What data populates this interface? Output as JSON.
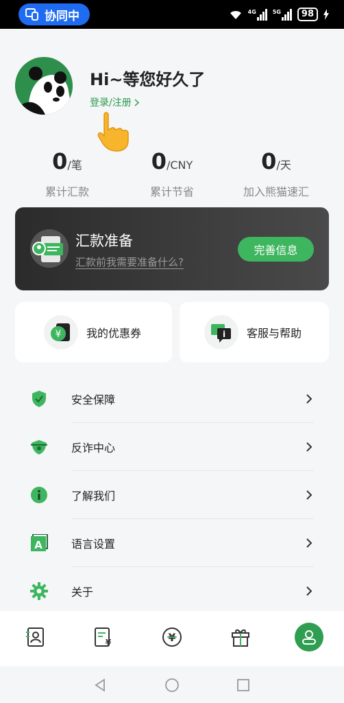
{
  "status_bar": {
    "collab_label": "协同中",
    "net1": "4G",
    "net2": "5G",
    "battery": "98"
  },
  "header": {
    "greeting": "Hi~等您好久了",
    "login_link": "登录/注册"
  },
  "stats": [
    {
      "value": "0",
      "unit": "/笔",
      "label": "累计汇款"
    },
    {
      "value": "0",
      "unit": "/CNY",
      "label": "累计节省"
    },
    {
      "value": "0",
      "unit": "/天",
      "label": "加入熊猫速汇"
    }
  ],
  "prep_card": {
    "title": "汇款准备",
    "subtitle": "汇款前我需要准备什么?",
    "button": "完善信息"
  },
  "shortcuts": [
    {
      "label": "我的优惠券",
      "icon": "coupon-icon"
    },
    {
      "label": "客服与帮助",
      "icon": "help-chat-icon"
    }
  ],
  "menu": [
    {
      "label": "安全保障",
      "icon": "shield-check-icon"
    },
    {
      "label": "反诈中心",
      "icon": "anti-fraud-icon"
    },
    {
      "label": "了解我们",
      "icon": "info-icon"
    },
    {
      "label": "语言设置",
      "icon": "language-icon"
    },
    {
      "label": "关于",
      "icon": "gear-icon"
    }
  ],
  "bottom_nav": [
    "contacts-icon",
    "orders-icon",
    "remit-icon",
    "gift-icon",
    "profile-icon"
  ],
  "colors": {
    "accent": "#3db65f",
    "blue": "#1f6cf2"
  }
}
